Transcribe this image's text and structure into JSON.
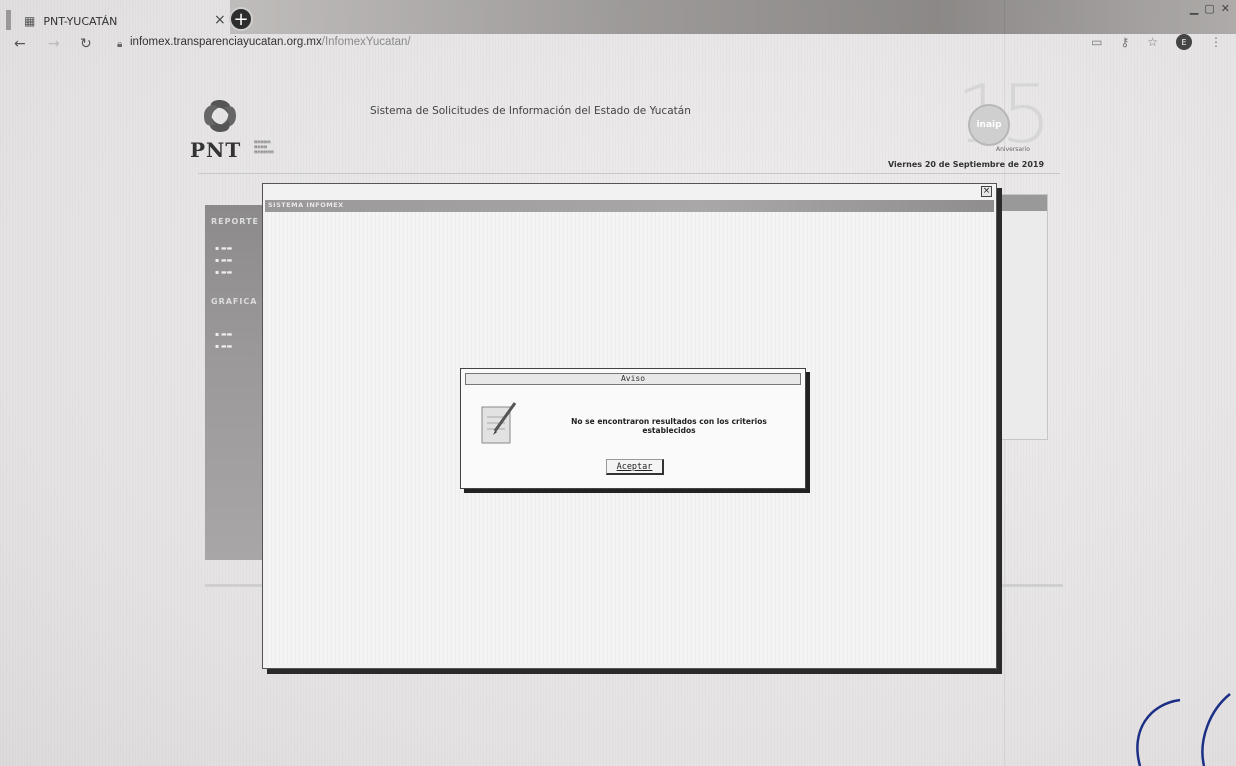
{
  "browser": {
    "tab_title": "PNT-YUCATÁN",
    "tab_close": "×",
    "new_tab": "+",
    "url_host": "infomex.transparenciayucatan.org.mx",
    "url_path": "/InfomexYucatan/",
    "profile_initial": "E"
  },
  "header": {
    "logo_text": "PNT",
    "system_title": "Sistema de Solicitudes de Información del Estado de Yucatán",
    "anniversary_number": "15",
    "anniversary_badge": "inaip",
    "anniversary_label": "Aniversario",
    "date": "Viernes 20 de Septiembre de 2019"
  },
  "sidebar": {
    "section_reports": "REPORTE",
    "section_graphs": "GRAFICA"
  },
  "modal": {
    "title": "SISTEMA INFOMEX",
    "close": "×"
  },
  "alert": {
    "title": "Aviso",
    "message": "No se encontraron resultados con los criterios establecidos",
    "button": "Aceptar"
  },
  "colors": {
    "sidebar": "#9a9898",
    "modal_titlebar": "#a9a7a7",
    "modal_bg": "#f2f2f2"
  }
}
